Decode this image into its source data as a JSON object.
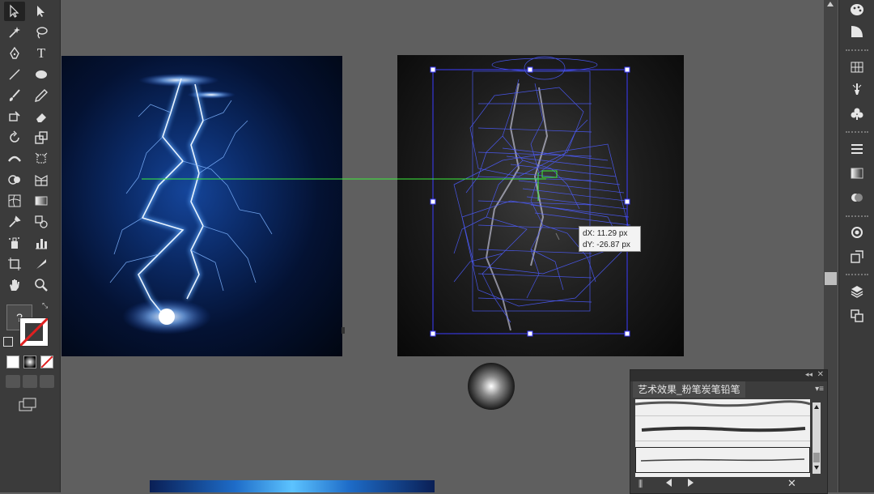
{
  "tooltip": {
    "dx": "dX: 11.29 px",
    "dy": "dY: -26.87 px"
  },
  "brushes_panel": {
    "tab_label": "艺术效果_粉笔炭笔铅笔"
  },
  "toolbar": {
    "type_tool_glyph": "T",
    "unknown_glyph": "?"
  },
  "colors": {
    "accent": "#2f6bff",
    "selection": "#5a5aff",
    "guide": "#3cf03c"
  }
}
